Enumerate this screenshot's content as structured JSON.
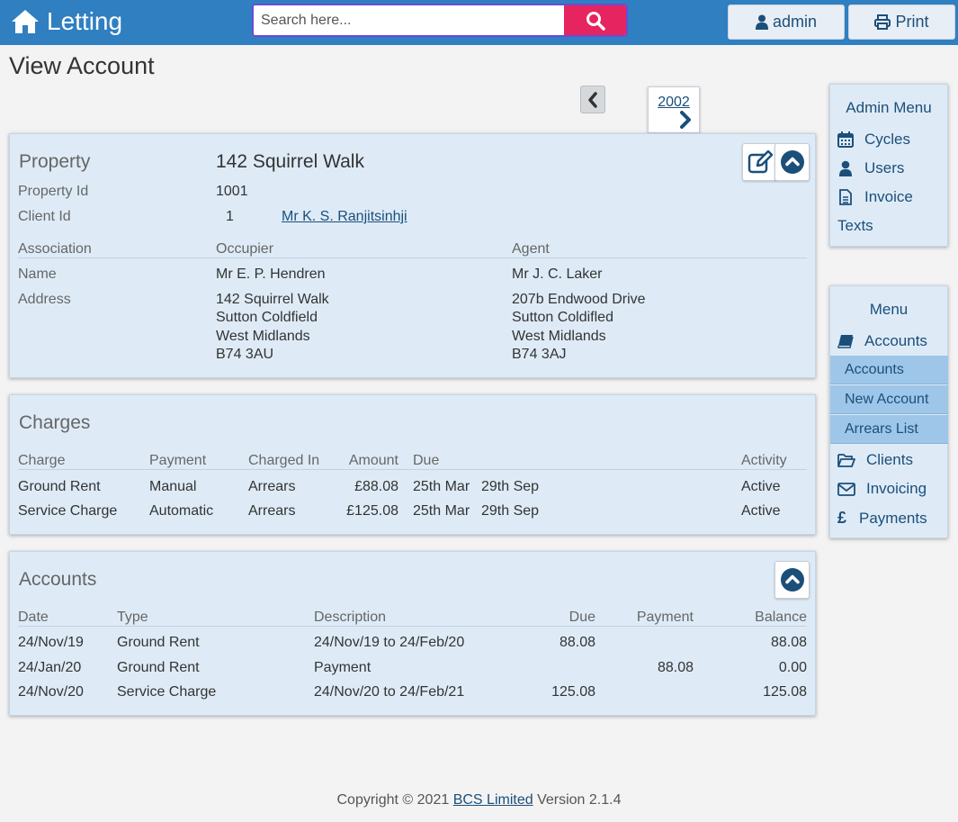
{
  "header": {
    "brand": "Letting",
    "search_placeholder": "Search here...",
    "admin_label": "admin",
    "print_label": "Print",
    "accent": "#2f7fc1",
    "search_button_color": "#e6245f"
  },
  "page": {
    "title": "View Account"
  },
  "year_nav": {
    "year": "2002"
  },
  "property": {
    "section_label": "Property",
    "address_title": "142 Squirrel Walk",
    "property_id_label": "Property Id",
    "property_id": "1001",
    "client_id_label": "Client Id",
    "client_id": "1",
    "client_name": "Mr K. S. Ranjitsinhji",
    "association_label": "Association",
    "occupier_label": "Occupier",
    "agent_label": "Agent",
    "name_label": "Name",
    "address_label": "Address",
    "occupier": {
      "name": "Mr E. P. Hendren",
      "address": [
        "142 Squirrel Walk",
        "Sutton Coldfield",
        "West Midlands",
        "B74 3AU"
      ]
    },
    "agent": {
      "name": "Mr J. C. Laker",
      "address": [
        "207b Endwood Drive",
        "Sutton Coldifled",
        "West Midlands",
        "B74 3AJ"
      ]
    }
  },
  "charges": {
    "title": "Charges",
    "headers": {
      "charge": "Charge",
      "payment": "Payment",
      "charged_in": "Charged In",
      "amount": "Amount",
      "due": "Due",
      "activity": "Activity"
    },
    "rows": [
      {
        "charge": "Ground Rent",
        "payment": "Manual",
        "charged_in": "Arrears",
        "amount": "£88.08",
        "due1": "25th Mar",
        "due2": "29th Sep",
        "activity": "Active"
      },
      {
        "charge": "Service Charge",
        "payment": "Automatic",
        "charged_in": "Arrears",
        "amount": "£125.08",
        "due1": "25th Mar",
        "due2": "29th Sep",
        "activity": "Active"
      }
    ]
  },
  "accounts": {
    "title": "Accounts",
    "headers": {
      "date": "Date",
      "type": "Type",
      "description": "Description",
      "due": "Due",
      "payment": "Payment",
      "balance": "Balance"
    },
    "rows": [
      {
        "date": "24/Nov/19",
        "type": "Ground Rent",
        "description": "24/Nov/19 to 24/Feb/20",
        "due": "88.08",
        "payment": "",
        "balance": "88.08"
      },
      {
        "date": "24/Jan/20",
        "type": "Ground Rent",
        "description": "Payment",
        "due": "",
        "payment": "88.08",
        "balance": "0.00"
      },
      {
        "date": "24/Nov/20",
        "type": "Service Charge",
        "description": "24/Nov/20 to 24/Feb/21",
        "due": "125.08",
        "payment": "",
        "balance": "125.08"
      }
    ]
  },
  "admin_menu": {
    "title": "Admin Menu",
    "items": [
      "Cycles",
      "Users",
      "Invoice",
      "Texts"
    ]
  },
  "menu": {
    "title": "Menu",
    "accounts_label": "Accounts",
    "sub_items": [
      "Accounts",
      "New Account",
      "Arrears List"
    ],
    "clients_label": "Clients",
    "invoicing_label": "Invoicing",
    "payments_label": "Payments"
  },
  "footer": {
    "copyright": "Copyright © 2021",
    "company": "BCS Limited",
    "version": "Version 2.1.4"
  }
}
